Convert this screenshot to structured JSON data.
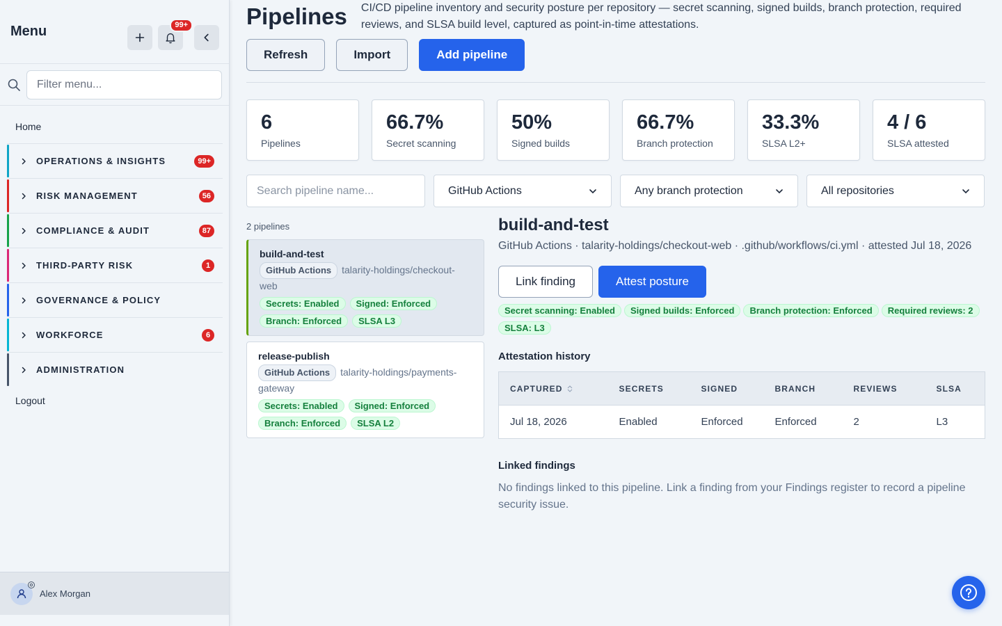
{
  "sidebar": {
    "title": "Menu",
    "notif_badge": "99+",
    "filter_placeholder": "Filter menu...",
    "home": "Home",
    "groups": [
      {
        "label": "OPERATIONS & INSIGHTS",
        "count": "99+",
        "color": "#0ea5c6"
      },
      {
        "label": "RISK MANAGEMENT",
        "count": "56",
        "color": "#dc2626"
      },
      {
        "label": "COMPLIANCE & AUDIT",
        "count": "87",
        "color": "#16a34a"
      },
      {
        "label": "THIRD-PARTY RISK",
        "count": "1",
        "color": "#db2777"
      },
      {
        "label": "GOVERNANCE & POLICY",
        "count": "",
        "color": "#2563eb"
      },
      {
        "label": "WORKFORCE",
        "count": "6",
        "color": "#06b6d4"
      },
      {
        "label": "ADMINISTRATION",
        "count": "",
        "color": "#475569"
      }
    ],
    "logout": "Logout",
    "user": "Alex Morgan"
  },
  "page": {
    "title": "Pipelines",
    "description": "CI/CD pipeline inventory and security posture per repository — secret scanning, signed builds, branch protection, required reviews, and SLSA build level, captured as point-in-time attestations.",
    "refresh": "Refresh",
    "import": "Import",
    "add": "Add pipeline"
  },
  "stats": [
    {
      "value": "6",
      "label": "Pipelines"
    },
    {
      "value": "66.7%",
      "label": "Secret scanning"
    },
    {
      "value": "50%",
      "label": "Signed builds"
    },
    {
      "value": "66.7%",
      "label": "Branch protection"
    },
    {
      "value": "33.3%",
      "label": "SLSA L2+"
    },
    {
      "value": "4 / 6",
      "label": "SLSA attested"
    }
  ],
  "filters": {
    "search_placeholder": "Search pipeline name...",
    "platform": "GitHub Actions",
    "branch": "Any branch protection",
    "repo": "All repositories"
  },
  "list": {
    "count": "2 pipelines",
    "items": [
      {
        "name": "build-and-test",
        "platform": "GitHub Actions",
        "repo": "talarity-holdings/checkout-web",
        "secrets": "Secrets: Enabled",
        "signed": "Signed: Enforced",
        "branch": "Branch: Enforced",
        "slsa": "SLSA L3"
      },
      {
        "name": "release-publish",
        "platform": "GitHub Actions",
        "repo": "talarity-holdings/payments-gateway",
        "secrets": "Secrets: Enabled",
        "signed": "Signed: Enforced",
        "branch": "Branch: Enforced",
        "slsa": "SLSA L2"
      }
    ]
  },
  "detail": {
    "title": "build-and-test",
    "subtitle": "GitHub Actions · talarity-holdings/checkout-web · .github/workflows/ci.yml · attested Jul 18, 2026",
    "link_finding": "Link finding",
    "attest": "Attest posture",
    "tags": [
      "Secret scanning: Enabled",
      "Signed builds: Enforced",
      "Branch protection: Enforced",
      "Required reviews: 2",
      "SLSA: L3"
    ],
    "history_title": "Attestation history",
    "columns": [
      "CAPTURED",
      "SECRETS",
      "SIGNED",
      "BRANCH",
      "REVIEWS",
      "SLSA"
    ],
    "rows": [
      [
        "Jul 18, 2026",
        "Enabled",
        "Enforced",
        "Enforced",
        "2",
        "L3"
      ]
    ],
    "linked_title": "Linked findings",
    "linked_empty": "No findings linked to this pipeline. Link a finding from your Findings register to record a pipeline security issue."
  }
}
